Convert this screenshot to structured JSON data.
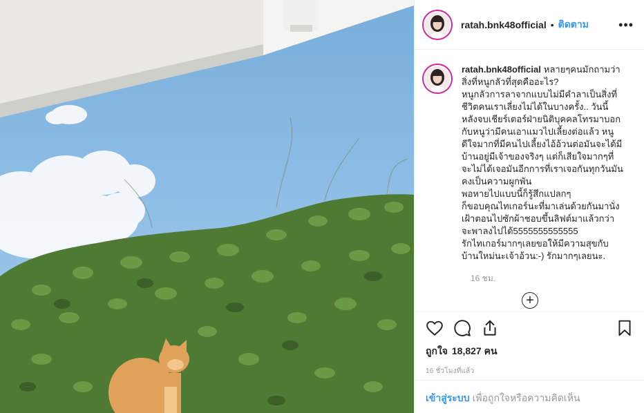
{
  "post": {
    "username": "ratah.bnk48official",
    "follow_label": "ติดตาม",
    "more_label": "•••",
    "caption_lines": [
      "หลายๆคนมักถามว่า",
      "สิ่งที่หนูกลัวที่สุดคืออะไร?",
      "หนูกลัวการลาจากแบบไม่มีคำลาเป็นสิ่งที่",
      "ชีวิตคนเราเลี่ยงไม่ได้ในบางครั้ง.. วันนี้",
      "หลังจบเชียร์เตอร์ฝ่ายนิติบุคคลโทรมาบอก",
      "กับหนูว่ามีคนเอาแมวไปเลี้ยงต่อแล้ว หนู",
      "ดีใจมากที่มีคนไปเลี้ยงไอ้อ้วนต่อมันจะได้มี",
      "บ้านอยู่มีเจ้าของจริงๆ แต่ก็เสียใจมากๆที่",
      "จะไม่ได้เจอมันอีกการที่เราเจอกันทุกวันมัน",
      "คงเป็นความผูกพัน",
      "พอหายไปแบบนี้ก็รู้สึกแปลกๆ",
      "ก็ขอบคุณไทเกอร์นะที่มาเล่นด้วยกันมานั่ง",
      "เฝ้าตอนไปซักผ้าชอบขึ้นลิฟต์มาแล้วกว่า",
      "จะพาลงไปได้5555555555555",
      "รักไทเกอร์มากๆเลยขอให้มีความสุขกับ",
      "บ้านใหม่นะเจ้าอ้วน:-) รักมากๆเลยนะ."
    ],
    "comment_time": "16 ชม.",
    "load_more_icon": "plus-circle-icon",
    "likes_label": "ถูกใจ",
    "likes_count": "18,827 คน",
    "timestamp": "16 ชั่วโมงที่แล้ว",
    "login_label": "เข้าสู่ระบบ",
    "login_rest": "เพื่อถูกใจหรือความคิดเห็น"
  },
  "colors": {
    "accent": "#3897f0",
    "text": "#262626",
    "muted": "#999999",
    "border": "#efefef",
    "story_ring": "#d6249f"
  },
  "icons": {
    "like": "heart-icon",
    "comment": "comment-icon",
    "share": "share-icon",
    "save": "bookmark-icon",
    "more": "more-options-icon"
  }
}
